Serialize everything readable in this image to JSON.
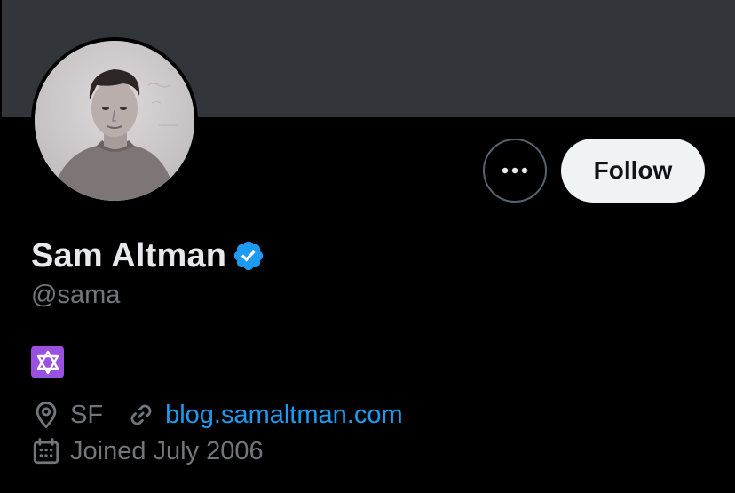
{
  "profile": {
    "display_name": "Sam Altman",
    "handle": "@sama",
    "bio_emoji": "star-of-david",
    "location": "SF",
    "website": "blog.samaltman.com",
    "joined": "Joined July 2006",
    "verified": true
  },
  "actions": {
    "follow_label": "Follow",
    "more_icon": "ellipsis-icon"
  },
  "colors": {
    "banner": "#323539",
    "background": "#000000",
    "primary_text": "#e7e9ea",
    "secondary_text": "#71767b",
    "link": "#1d9bf0",
    "verified_badge": "#1d9bf0",
    "follow_button_bg": "#eff3f4",
    "bio_emoji_bg": "#9b51e0"
  }
}
